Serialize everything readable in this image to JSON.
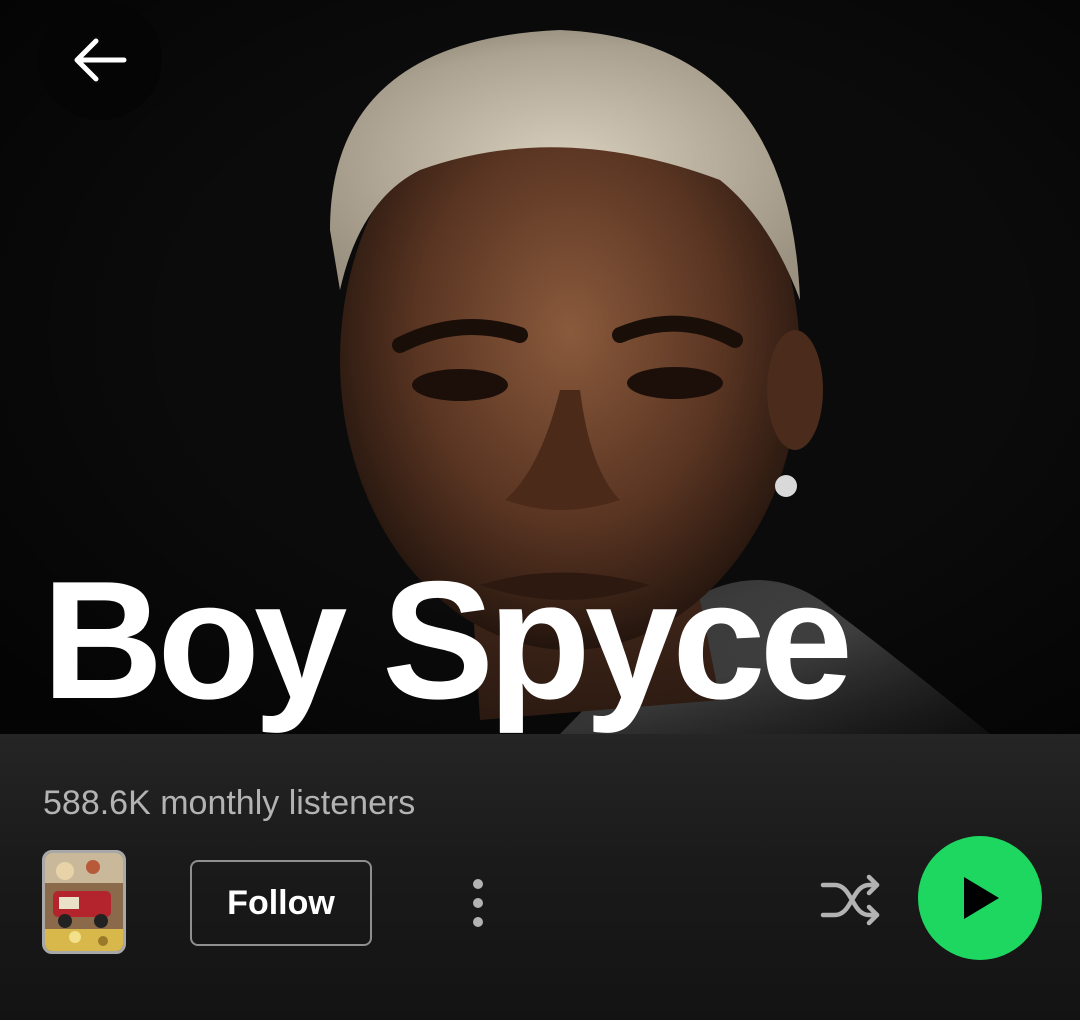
{
  "header": {
    "back_icon": "arrow-left-icon"
  },
  "artist": {
    "name": "Boy Spyce",
    "monthly_listeners": "588.6K monthly listeners"
  },
  "actions": {
    "follow_label": "Follow",
    "more_icon": "vertical-ellipsis-icon",
    "shuffle_icon": "shuffle-icon",
    "play_icon": "play-icon"
  },
  "colors": {
    "accent": "#1ed760",
    "background": "#121212",
    "secondary_text": "#b3b3b3"
  }
}
